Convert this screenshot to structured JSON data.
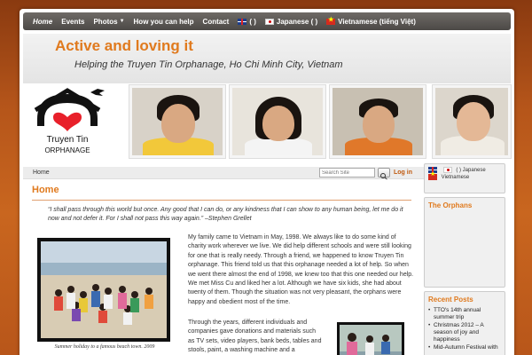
{
  "nav": {
    "items": [
      {
        "label": "Home",
        "active": true
      },
      {
        "label": "Events"
      },
      {
        "label": "Photos",
        "dropdown": true
      },
      {
        "label": "How you can help"
      },
      {
        "label": "Contact"
      }
    ],
    "lang_en": "(   )",
    "lang_jp": "Japanese (    )",
    "lang_vn": "Vietnamese (tiếng Việt)"
  },
  "header": {
    "title": "Active and loving it",
    "tagline": "Helping the Truyen Tin Orphanage, Ho Chi Minh City, Vietnam"
  },
  "logo": {
    "line1": "Truyen Tin",
    "line2": "ORPHANAGE"
  },
  "toolbar": {
    "breadcrumb": "Home",
    "search_placeholder": "Search Site",
    "login_label": "Log in"
  },
  "main": {
    "heading": "Home",
    "quote": "“I shall pass through this world but once. Any good that I can do, or any kindness that I can show to any human being, let me do it now and not defer it. For I shall not pass this way again.” –Stephen Grellet",
    "para1": "My family came to Vietnam in May, 1998. We always like to do some kind of charity work wherever we live. We did help different schools and were still looking for one that is really needy. Through a friend, we happened to know Truyen Tin orphanage. This friend told us that this orphanage needed a lot of help. So when we went there almost the end of 1998, we knew too that this one needed our help. We met Miss Cu and liked her a lot. Although we have six kids, she had about twenty of them. Though the situation was not very pleasant, the orphans were happy and obedient most of the time.",
    "para2": "Through the years, different individuals and companies gave donations and materials such as TV sets, video players, bank beds, tables and stools, paint, a washing machine and a refrigerator. Last ten years they were",
    "photo_caption": "Summer holiday to a famous beach town. 2009"
  },
  "sidebar": {
    "lang_line1": "(     )  Japanese",
    "lang_line2": "Vietnamese",
    "orphans_title": "The Orphans",
    "recent_title": "Recent Posts",
    "recent_posts": [
      "TTO's 14th annual summer trip",
      "Christmas 2012 – A season of joy and happiness",
      "Mid-Autumn Festival with"
    ]
  },
  "colors": {
    "accent": "#e07a1e",
    "nav_bg": "#4c4946",
    "logo_heart": "#e8202a"
  }
}
